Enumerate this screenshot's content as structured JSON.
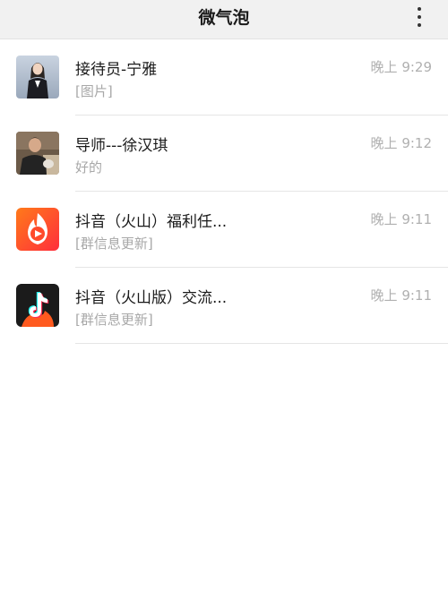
{
  "header": {
    "title": "微气泡",
    "more_icon": "more-vertical-icon"
  },
  "chats": [
    {
      "name": "接待员-宁雅",
      "preview": "[图片]",
      "time": "晚上 9:29",
      "avatar": "person-photo"
    },
    {
      "name": "导师---徐汉琪",
      "preview": "好的",
      "time": "晚上 9:12",
      "avatar": "person-photo"
    },
    {
      "name": "抖音（火山）福利任...",
      "preview": "[群信息更新]",
      "time": "晚上 9:11",
      "avatar": "huoshan-logo-icon"
    },
    {
      "name": "抖音（火山版）交流...",
      "preview": "[群信息更新]",
      "time": "晚上 9:11",
      "avatar": "douyin-huoshan-logo-icon"
    }
  ],
  "colors": {
    "header_bg": "#f1f1f1",
    "huoshan_orange": "#ff5a22",
    "douyin_dark": "#1b1b1b"
  }
}
